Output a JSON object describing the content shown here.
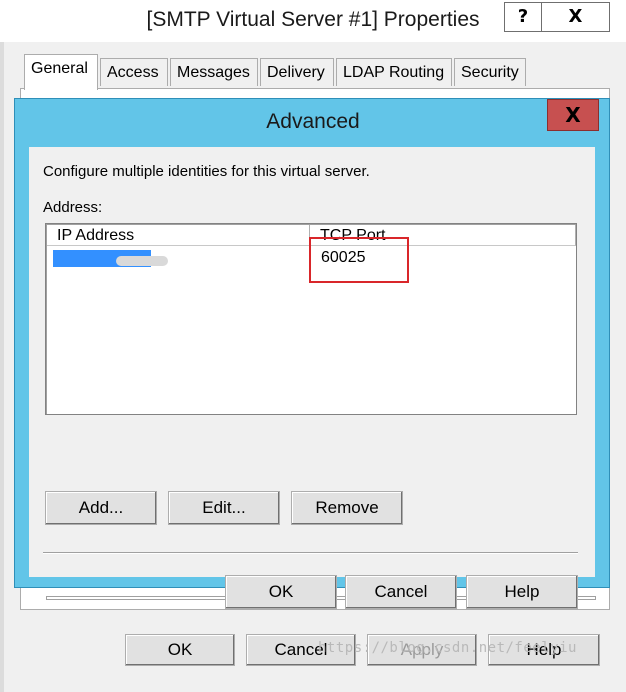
{
  "parent_window": {
    "title": "[SMTP Virtual Server #1] Properties",
    "help_glyph": "?",
    "close_glyph": "X",
    "tabs": [
      {
        "label": "General",
        "active": true
      },
      {
        "label": "Access",
        "active": false
      },
      {
        "label": "Messages",
        "active": false
      },
      {
        "label": "Delivery",
        "active": false
      },
      {
        "label": "LDAP Routing",
        "active": false
      },
      {
        "label": "Security",
        "active": false
      }
    ],
    "buttons": {
      "ok": "OK",
      "cancel": "Cancel",
      "apply": "Apply",
      "help": "Help"
    }
  },
  "advanced_dialog": {
    "title": "Advanced",
    "close_glyph": "X",
    "description": "Configure multiple identities for this virtual server.",
    "address_label": "Address:",
    "columns": {
      "ip": "IP Address",
      "port": "TCP Port"
    },
    "rows": [
      {
        "ip": "",
        "port": "60025",
        "selected": true
      }
    ],
    "list_buttons": {
      "add": "Add...",
      "edit": "Edit...",
      "remove": "Remove"
    },
    "dialog_buttons": {
      "ok": "OK",
      "cancel": "Cancel",
      "help": "Help"
    }
  },
  "watermark": "https://blog.csdn.net/feelyiu",
  "colors": {
    "dialog_frame": "#62c5e8",
    "close_button": "#c75050",
    "selection": "#3390ff",
    "annotation_box": "#d9262a"
  }
}
